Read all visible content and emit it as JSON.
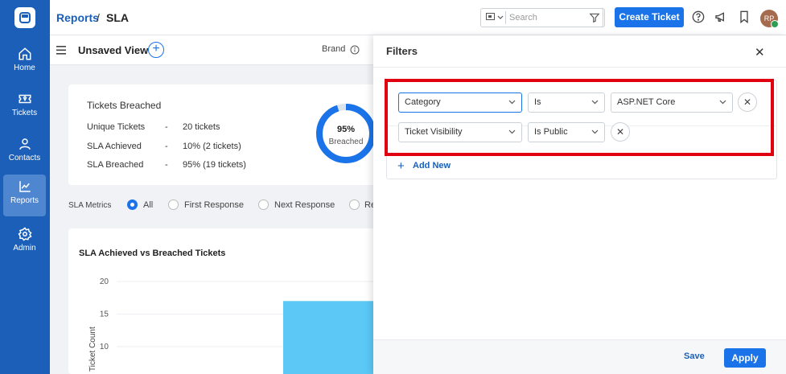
{
  "sidebar": {
    "items": [
      {
        "label": "Home",
        "icon": "home-icon"
      },
      {
        "label": "Tickets",
        "icon": "ticket-icon"
      },
      {
        "label": "Contacts",
        "icon": "person-icon"
      },
      {
        "label": "Reports",
        "icon": "chart-icon",
        "active": true
      },
      {
        "label": "Admin",
        "icon": "gear-icon"
      }
    ]
  },
  "topbar": {
    "breadcrumb_parent": "Reports",
    "breadcrumb_sep": "/",
    "breadcrumb_current": "SLA",
    "search_placeholder": "Search",
    "create_label": "Create Ticket",
    "avatar_initials": "RP"
  },
  "viewbar": {
    "title": "Unsaved View",
    "brand_label": "Brand"
  },
  "summary": {
    "title": "Tickets Breached",
    "rows": [
      {
        "label": "Unique Tickets",
        "dash": "-",
        "value": "20 tickets"
      },
      {
        "label": "SLA Achieved",
        "dash": "-",
        "value": "10% (2 tickets)"
      },
      {
        "label": "SLA Breached",
        "dash": "-",
        "value": "95% (19 tickets)"
      }
    ],
    "donut_pct": "95%",
    "donut_label": "Breached",
    "donut_fraction": 0.95
  },
  "metrics": {
    "label": "SLA Metrics",
    "options": [
      "All",
      "First Response",
      "Next Response",
      "Re"
    ],
    "selected": "All"
  },
  "chart": {
    "title": "SLA Achieved vs Breached Tickets"
  },
  "chart_data": {
    "type": "bar",
    "title": "SLA Achieved vs Breached Tickets",
    "ylabel": "Ticket Count",
    "xlabel": "",
    "ylim": [
      0,
      20
    ],
    "yticks": [
      10,
      15,
      20
    ],
    "bars": [
      17
    ]
  },
  "filters": {
    "title": "Filters",
    "rows": [
      {
        "field": "Category",
        "operator": "Is",
        "value": "ASP.NET Core"
      },
      {
        "field": "Ticket Visibility",
        "operator": "Is Public"
      }
    ],
    "add_new": "Add New",
    "save": "Save",
    "apply": "Apply"
  },
  "colors": {
    "sidebar": "#1b5fb8",
    "primary": "#1a73e8",
    "highlight": "#e00010",
    "bar": "#5bc8f5"
  }
}
